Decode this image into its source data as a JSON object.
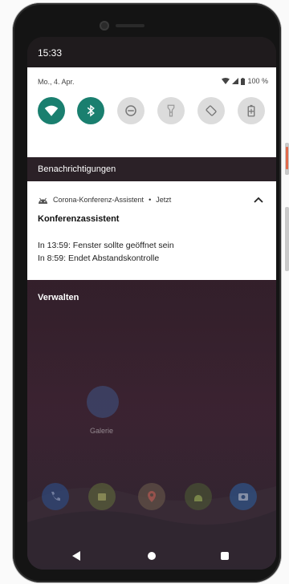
{
  "status_bar": {
    "time": "15:33"
  },
  "quick_settings": {
    "date": "Mo., 4. Apr.",
    "battery": "100 %",
    "tiles": [
      {
        "name": "wifi-tile",
        "icon": "wifi-icon",
        "on": true
      },
      {
        "name": "bluetooth-tile",
        "icon": "bluetooth-icon",
        "on": true
      },
      {
        "name": "dnd-tile",
        "icon": "do-not-disturb-icon",
        "on": false
      },
      {
        "name": "flashlight-tile",
        "icon": "flashlight-icon",
        "on": false
      },
      {
        "name": "autorotate-tile",
        "icon": "autorotate-icon",
        "on": false
      },
      {
        "name": "battery-saver-tile",
        "icon": "battery-saver-icon",
        "on": false
      }
    ],
    "colors": {
      "on": "#1a7f6f",
      "off": "#dcdcdc"
    }
  },
  "notifications": {
    "header": "Benachrichtigungen",
    "card": {
      "app_name": "Corona-Konferenz-Assistent",
      "separator": "•",
      "time": "Jetzt",
      "title": "Konferenzassistent",
      "lines": [
        "In 13:59: Fenster sollte geöffnet sein",
        "In 8:59: Endet Abstandskontrolle"
      ]
    },
    "manage_label": "Verwalten"
  },
  "home": {
    "gallery_label": "Galerie",
    "dock": [
      "phone-icon",
      "store-icon",
      "maps-icon",
      "android-icon",
      "camera-icon"
    ]
  }
}
